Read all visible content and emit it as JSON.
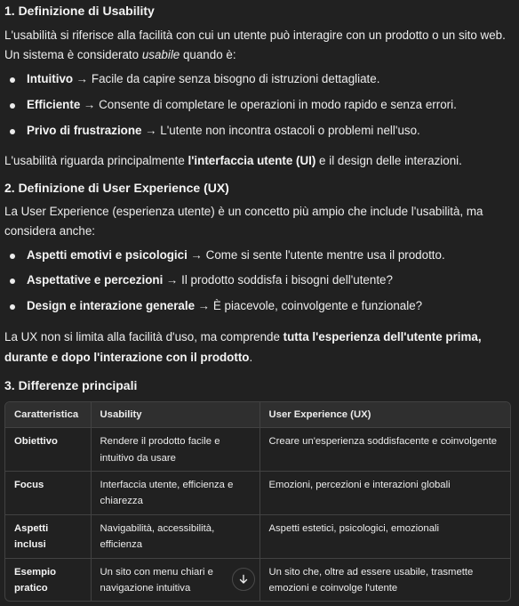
{
  "section1": {
    "title": "1. Definizione di Usability",
    "intro_a": "L'usabilità si riferisce alla facilità con cui un utente può interagire con un prodotto o un sito web. Un sistema è considerato ",
    "intro_em": "usabile",
    "intro_b": " quando è:",
    "items": [
      {
        "term": "Intuitivo",
        "desc": " → Facile da capire senza bisogno di istruzioni dettagliate."
      },
      {
        "term": "Efficiente",
        "desc": " → Consente di completare le operazioni in modo rapido e senza errori."
      },
      {
        "term": "Privo di frustrazione",
        "desc": " → L'utente non incontra ostacoli o problemi nell'uso."
      }
    ],
    "close_a": "L'usabilità riguarda principalmente ",
    "close_strong": "l'interfaccia utente (UI)",
    "close_b": " e il design delle interazioni."
  },
  "section2": {
    "title": "2. Definizione di User Experience (UX)",
    "intro": "La User Experience (esperienza utente) è un concetto più ampio che include l'usabilità, ma considera anche:",
    "items": [
      {
        "term": "Aspetti emotivi e psicologici",
        "desc": " → Come si sente l'utente mentre usa il prodotto."
      },
      {
        "term": "Aspettative e percezioni",
        "desc": " → Il prodotto soddisfa i bisogni dell'utente?"
      },
      {
        "term": "Design e interazione generale",
        "desc": " → È piacevole, coinvolgente e funzionale?"
      }
    ],
    "close_a": "La UX non si limita alla facilità d'uso, ma comprende ",
    "close_strong": "tutta l'esperienza dell'utente prima, durante e dopo l'interazione con il prodotto",
    "close_b": "."
  },
  "section3": {
    "title": "3. Differenze principali",
    "table": {
      "headers": [
        "Caratteristica",
        "Usability",
        "User Experience (UX)"
      ],
      "rows": [
        [
          "Obiettivo",
          "Rendere il prodotto facile e intuitivo da usare",
          "Creare un'esperienza soddisfacente e coinvolgente"
        ],
        [
          "Focus",
          "Interfaccia utente, efficienza e chiarezza",
          "Emozioni, percezioni e interazioni globali"
        ],
        [
          "Aspetti inclusi",
          "Navigabilità, accessibilità, efficienza",
          "Aspetti estetici, psicologici, emozionali"
        ],
        [
          "Esempio pratico",
          "Un sito con menu chiari e navigazione intuitiva",
          "Un sito che, oltre ad essere usabile, trasmette emozioni e coinvolge l'utente"
        ]
      ]
    }
  },
  "icons": {
    "scroll_down": "arrow-down-icon"
  }
}
